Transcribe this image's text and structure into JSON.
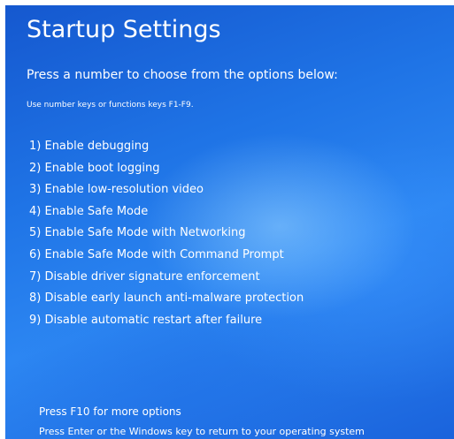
{
  "screen": {
    "title": "Startup Settings",
    "subtitle": "Press a number to choose from the options below:",
    "hint": "Use number keys or functions keys F1-F9."
  },
  "options": [
    {
      "label": "1) Enable debugging"
    },
    {
      "label": "2) Enable boot logging"
    },
    {
      "label": "3) Enable low-resolution video"
    },
    {
      "label": "4) Enable Safe Mode"
    },
    {
      "label": "5) Enable Safe Mode with Networking"
    },
    {
      "label": "6) Enable Safe Mode with Command Prompt"
    },
    {
      "label": "7) Disable driver signature enforcement"
    },
    {
      "label": "8) Disable early launch anti-malware protection"
    },
    {
      "label": "9) Disable automatic restart after failure"
    }
  ],
  "footer": {
    "more_options": "Press F10 for more options",
    "return_text": "Press Enter or the Windows key to return to your operating system"
  },
  "colors": {
    "background": "#1f74e6",
    "text": "#ffffff"
  }
}
